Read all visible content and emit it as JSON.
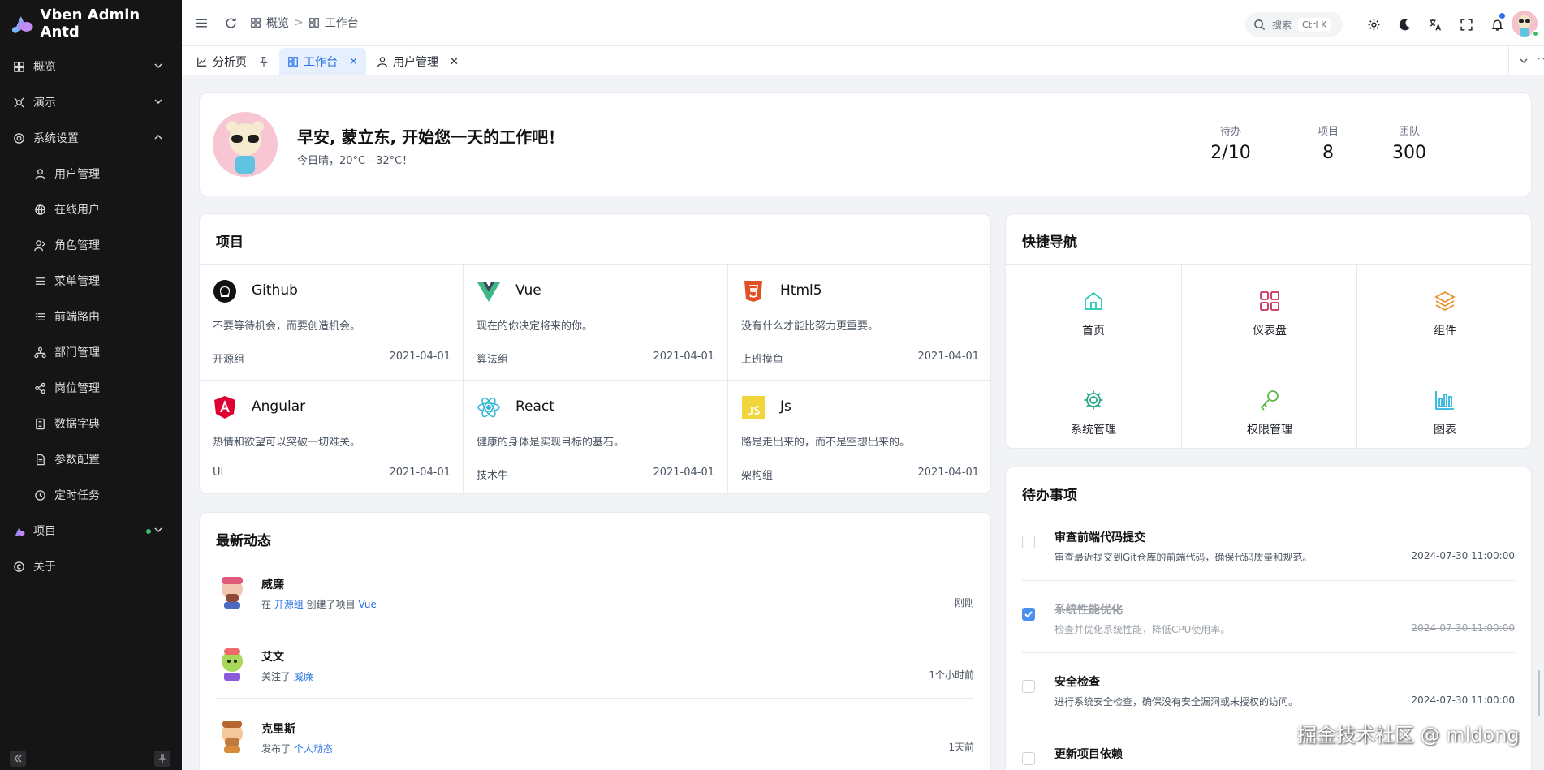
{
  "sidebar": {
    "brand": "Vben Admin Antd",
    "items": [
      {
        "label": "概览",
        "icon": "dashboard-icon",
        "expandable": true
      },
      {
        "label": "演示",
        "icon": "demo-icon",
        "expandable": true
      },
      {
        "label": "系统设置",
        "icon": "settings-icon",
        "expanded": true
      },
      {
        "label": "用户管理",
        "icon": "user-icon"
      },
      {
        "label": "在线用户",
        "icon": "online-user-icon"
      },
      {
        "label": "角色管理",
        "icon": "role-icon"
      },
      {
        "label": "菜单管理",
        "icon": "menu-icon"
      },
      {
        "label": "前端路由",
        "icon": "route-icon"
      },
      {
        "label": "部门管理",
        "icon": "dept-icon"
      },
      {
        "label": "岗位管理",
        "icon": "post-icon"
      },
      {
        "label": "数据字典",
        "icon": "dict-icon"
      },
      {
        "label": "参数配置",
        "icon": "config-icon"
      },
      {
        "label": "定时任务",
        "icon": "clock-icon"
      },
      {
        "label": "项目",
        "icon": "project-logo-icon",
        "expandable": true
      },
      {
        "label": "关于",
        "icon": "copyright-icon"
      }
    ]
  },
  "header": {
    "breadcrumb": [
      "概览",
      "工作台"
    ],
    "search_placeholder": "搜索",
    "search_shortcut": "Ctrl K"
  },
  "tabs": [
    {
      "label": "分析页",
      "icon": "chart-icon",
      "pinned": true
    },
    {
      "label": "工作台",
      "icon": "workbench-icon",
      "active": true
    },
    {
      "label": "用户管理",
      "icon": "user-icon"
    }
  ],
  "welcome": {
    "greeting": "早安, 蒙立东, 开始您一天的工作吧！",
    "weather": "今日晴，20°C - 32°C！",
    "stats": [
      {
        "label": "待办",
        "value": "2/10"
      },
      {
        "label": "项目",
        "value": "8"
      },
      {
        "label": "团队",
        "value": "300"
      }
    ]
  },
  "projects": {
    "title": "项目",
    "items": [
      {
        "name": "Github",
        "desc": "不要等待机会，而要创造机会。",
        "group": "开源组",
        "date": "2021-04-01",
        "color": "#111111"
      },
      {
        "name": "Vue",
        "desc": "现在的你决定将来的你。",
        "group": "算法组",
        "date": "2021-04-01",
        "color": "#41b883"
      },
      {
        "name": "Html5",
        "desc": "没有什么才能比努力更重要。",
        "group": "上班摸鱼",
        "date": "2021-04-01",
        "color": "#e34f26"
      },
      {
        "name": "Angular",
        "desc": "热情和欲望可以突破一切难关。",
        "group": "UI",
        "date": "2021-04-01",
        "color": "#dd0031"
      },
      {
        "name": "React",
        "desc": "健康的身体是实现目标的基石。",
        "group": "技术牛",
        "date": "2021-04-01",
        "color": "#2fb6d6"
      },
      {
        "name": "Js",
        "desc": "路是走出来的，而不是空想出来的。",
        "group": "架构组",
        "date": "2021-04-01",
        "color": "#f0d53b"
      }
    ]
  },
  "quick_nav": {
    "title": "快捷导航",
    "items": [
      {
        "label": "首页",
        "icon": "home-icon",
        "color": "#1fc9b0"
      },
      {
        "label": "仪表盘",
        "icon": "dashboard-grid-icon",
        "color": "#c7315a"
      },
      {
        "label": "组件",
        "icon": "layers-icon",
        "color": "#e8912a"
      },
      {
        "label": "系统管理",
        "icon": "gear-icon",
        "color": "#2aa88a"
      },
      {
        "label": "权限管理",
        "icon": "key-icon",
        "color": "#5fb84a"
      },
      {
        "label": "图表",
        "icon": "bar-chart-icon",
        "color": "#2ab6e0"
      }
    ]
  },
  "feed": {
    "title": "最新动态",
    "items": [
      {
        "name": "威廉",
        "prefix": "在 ",
        "link1": "开源组",
        "middle": " 创建了项目 ",
        "link2": "Vue",
        "time": "刚刚"
      },
      {
        "name": "艾文",
        "prefix": "关注了 ",
        "link1": "威廉",
        "middle": "",
        "link2": "",
        "time": "1个小时前"
      },
      {
        "name": "克里斯",
        "prefix": "发布了 ",
        "link1": "个人动态",
        "middle": "",
        "link2": "",
        "time": "1天前"
      }
    ]
  },
  "todo": {
    "title": "待办事项",
    "items": [
      {
        "title": "审查前端代码提交",
        "desc": "审查最近提交到Git仓库的前端代码，确保代码质量和规范。",
        "time": "2024-07-30 11:00:00",
        "done": false
      },
      {
        "title": "系统性能优化",
        "desc": "检查并优化系统性能，降低CPU使用率。",
        "time": "2024-07-30 11:00:00",
        "done": true
      },
      {
        "title": "安全检查",
        "desc": "进行系统安全检查，确保没有安全漏洞或未授权的访问。",
        "time": "2024-07-30 11:00:00",
        "done": false
      },
      {
        "title": "更新项目依赖",
        "desc": "",
        "time": "",
        "done": false
      }
    ]
  },
  "watermark": "掘金技术社区 @ mldong"
}
